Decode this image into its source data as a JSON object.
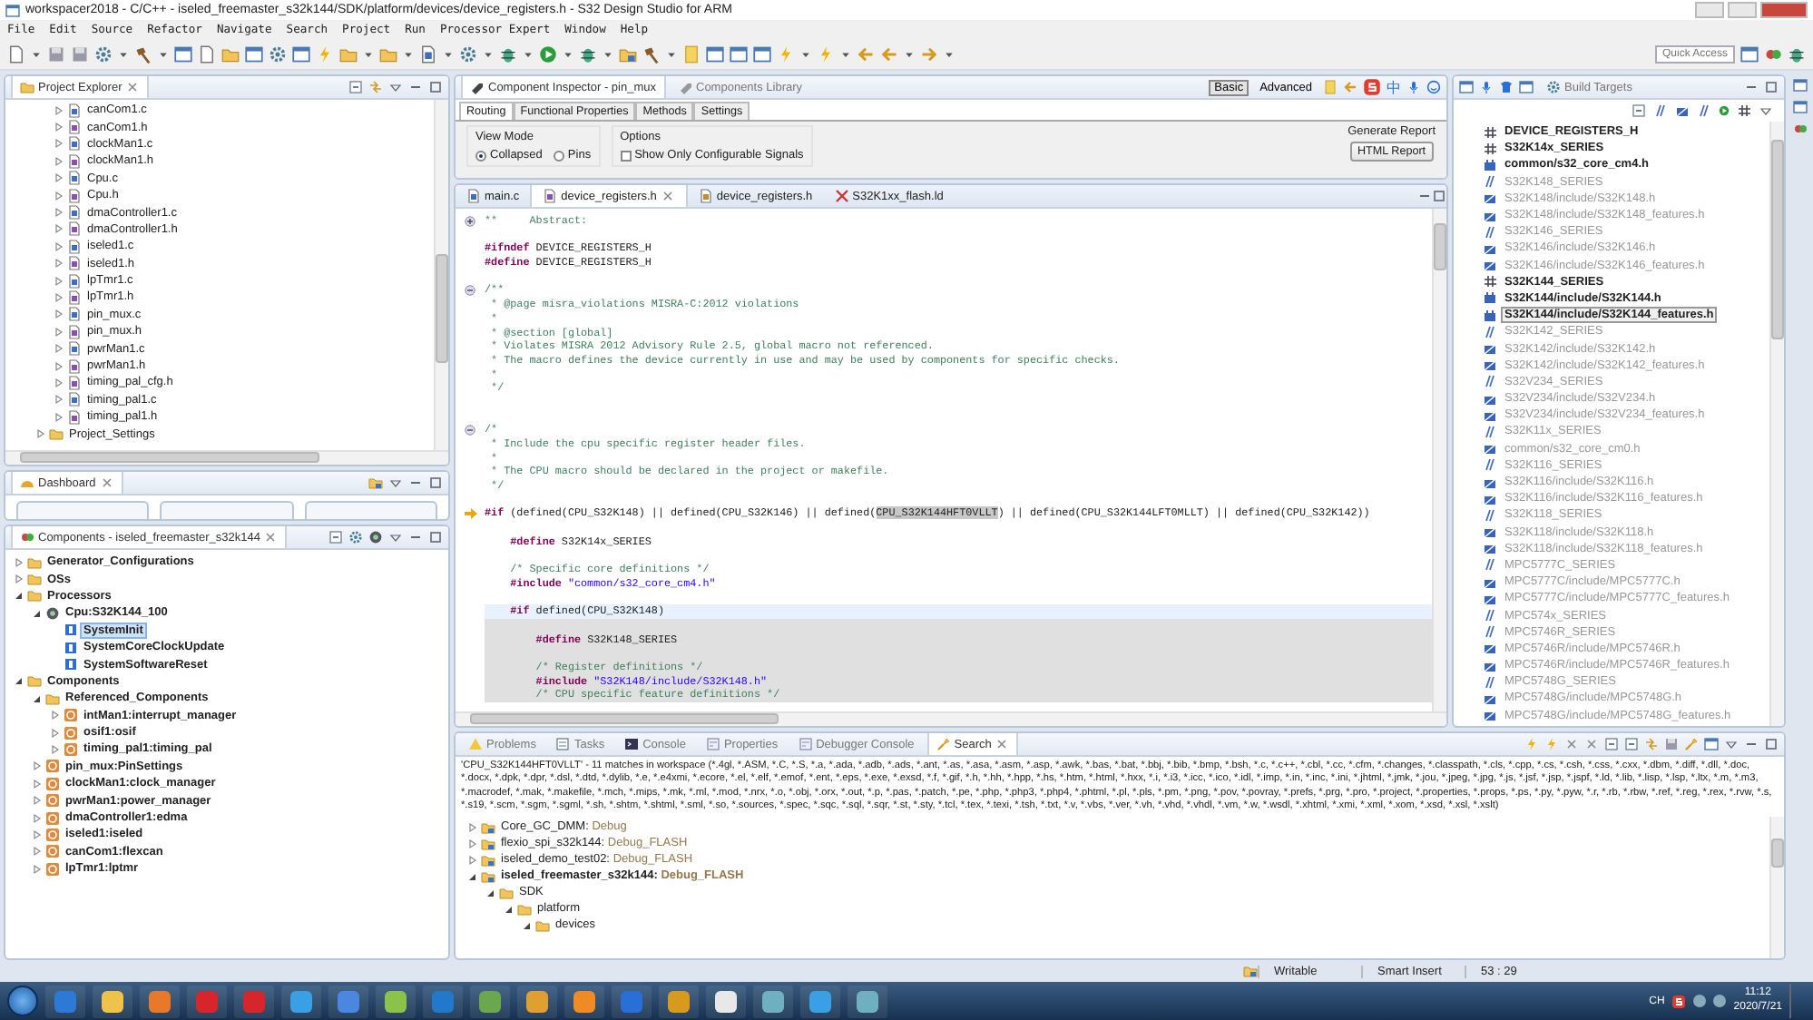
{
  "window": {
    "title": "workspacer2018 - C/C++ - iseled_freemaster_s32k144/SDK/platform/devices/device_registers.h - S32 Design Studio for ARM"
  },
  "menu": [
    "File",
    "Edit",
    "Source",
    "Refactor",
    "Navigate",
    "Search",
    "Project",
    "Run",
    "Processor Expert",
    "Window",
    "Help"
  ],
  "toolbar": {
    "quick_access": {
      "placeholder": "Quick Access"
    }
  },
  "project_explorer": {
    "title": "Project Explorer",
    "items": [
      {
        "label": "canCom1.c",
        "kind": "c"
      },
      {
        "label": "canCom1.h",
        "kind": "h"
      },
      {
        "label": "clockMan1.c",
        "kind": "c"
      },
      {
        "label": "clockMan1.h",
        "kind": "h"
      },
      {
        "label": "Cpu.c",
        "kind": "c"
      },
      {
        "label": "Cpu.h",
        "kind": "h"
      },
      {
        "label": "dmaController1.c",
        "kind": "c"
      },
      {
        "label": "dmaController1.h",
        "kind": "h"
      },
      {
        "label": "iseled1.c",
        "kind": "c"
      },
      {
        "label": "iseled1.h",
        "kind": "h"
      },
      {
        "label": "lpTmr1.c",
        "kind": "c"
      },
      {
        "label": "lpTmr1.h",
        "kind": "h"
      },
      {
        "label": "pin_mux.c",
        "kind": "c"
      },
      {
        "label": "pin_mux.h",
        "kind": "h"
      },
      {
        "label": "pwrMan1.c",
        "kind": "c"
      },
      {
        "label": "pwrMan1.h",
        "kind": "h"
      },
      {
        "label": "timing_pal_cfg.h",
        "kind": "h"
      },
      {
        "label": "timing_pal1.c",
        "kind": "c"
      },
      {
        "label": "timing_pal1.h",
        "kind": "h"
      },
      {
        "label": "Project_Settings",
        "kind": "folder"
      }
    ]
  },
  "dashboard": {
    "title": "Dashboard"
  },
  "components": {
    "title": "Components - iseled_freemaster_s32k144",
    "tree": [
      {
        "label": "Generator_Configurations",
        "kind": "folder",
        "expanded": false,
        "selected": false
      },
      {
        "label": "OSs",
        "kind": "folder",
        "expanded": false,
        "selected": false
      },
      {
        "label": "Processors",
        "kind": "folder",
        "expanded": true,
        "selected": false,
        "children": [
          {
            "label": "Cpu:S32K144_100",
            "kind": "cpu",
            "expanded": true,
            "selected": false,
            "children": [
              {
                "label": "SystemInit",
                "kind": "method",
                "selected": true
              },
              {
                "label": "SystemCoreClockUpdate",
                "kind": "method",
                "selected": false
              },
              {
                "label": "SystemSoftwareReset",
                "kind": "method",
                "selected": false
              }
            ]
          }
        ]
      },
      {
        "label": "Components",
        "kind": "folder",
        "expanded": true,
        "selected": false,
        "children": [
          {
            "label": "Referenced_Components",
            "kind": "folder",
            "expanded": true,
            "selected": false,
            "children": [
              {
                "label": "intMan1:interrupt_manager",
                "kind": "component",
                "expanded": false,
                "selected": false
              },
              {
                "label": "osif1:osif",
                "kind": "component",
                "expanded": false,
                "selected": false
              },
              {
                "label": "timing_pal1:timing_pal",
                "kind": "component",
                "expanded": false,
                "selected": false
              }
            ]
          },
          {
            "label": "pin_mux:PinSettings",
            "kind": "component",
            "expanded": false,
            "selected": false
          },
          {
            "label": "clockMan1:clock_manager",
            "kind": "component",
            "expanded": false,
            "selected": false
          },
          {
            "label": "pwrMan1:power_manager",
            "kind": "component",
            "expanded": false,
            "selected": false
          },
          {
            "label": "dmaController1:edma",
            "kind": "component",
            "expanded": false,
            "selected": false
          },
          {
            "label": "iseled1:iseled",
            "kind": "component",
            "expanded": false,
            "selected": false
          },
          {
            "label": "canCom1:flexcan",
            "kind": "component",
            "expanded": false,
            "selected": false
          },
          {
            "label": "lpTmr1:lptmr",
            "kind": "component",
            "expanded": false,
            "selected": false
          }
        ]
      }
    ]
  },
  "inspector": {
    "tabs": [
      {
        "label": "Component Inspector - pin_mux",
        "selected": true
      },
      {
        "label": "Components Library",
        "selected": false
      }
    ],
    "modes": [
      {
        "label": "Basic",
        "selected": true
      },
      {
        "label": "Advanced",
        "selected": false
      }
    ],
    "ime_mode": "中",
    "subtabs": [
      {
        "label": "Routing",
        "selected": true
      },
      {
        "label": "Functional Properties",
        "selected": false
      },
      {
        "label": "Methods",
        "selected": false
      },
      {
        "label": "Settings",
        "selected": false
      }
    ],
    "view_mode": {
      "label": "View Mode",
      "options": [
        {
          "label": "Collapsed",
          "selected": true
        },
        {
          "label": "Pins",
          "selected": false
        }
      ]
    },
    "options": {
      "label": "Options",
      "checkbox": {
        "label": "Show Only Configurable Signals",
        "checked": false
      }
    },
    "report": {
      "label": "Generate Report",
      "button": "HTML Report"
    }
  },
  "editor": {
    "tabs": [
      {
        "label": "main.c",
        "kind": "c",
        "selected": false
      },
      {
        "label": "device_registers.h",
        "kind": "h",
        "selected": true
      },
      {
        "label": "device_registers.h",
        "kind": "h-external",
        "selected": false
      },
      {
        "label": "S32K1xx_flash.ld",
        "kind": "linker",
        "selected": false
      }
    ],
    "lines": [
      {
        "kind": "normal",
        "gutter": {
          "kind": "fold-expand"
        },
        "segments": [
          {
            "kind": "comment",
            "text": "**     Abstract:"
          }
        ]
      },
      {
        "kind": "normal"
      },
      {
        "kind": "normal",
        "segments": [
          {
            "kind": "keyword",
            "text": "#ifndef"
          },
          {
            "kind": "plain",
            "text": " DEVICE_REGISTERS_H"
          }
        ]
      },
      {
        "kind": "normal",
        "segments": [
          {
            "kind": "keyword",
            "text": "#define"
          },
          {
            "kind": "plain",
            "text": " DEVICE_REGISTERS_H"
          }
        ]
      },
      {
        "kind": "normal"
      },
      {
        "kind": "normal",
        "gutter": {
          "kind": "fold-collapse"
        },
        "segments": [
          {
            "kind": "comment",
            "text": "/**"
          }
        ]
      },
      {
        "kind": "normal",
        "segments": [
          {
            "kind": "comment",
            "text": " * @page misra_violations MISRA-C:2012 violations"
          }
        ]
      },
      {
        "kind": "normal",
        "segments": [
          {
            "kind": "comment",
            "text": " *"
          }
        ]
      },
      {
        "kind": "normal",
        "segments": [
          {
            "kind": "comment",
            "text": " * @section [global]"
          }
        ]
      },
      {
        "kind": "normal",
        "segments": [
          {
            "kind": "comment",
            "text": " * Violates MISRA 2012 Advisory Rule 2.5, global macro not referenced."
          }
        ]
      },
      {
        "kind": "normal",
        "segments": [
          {
            "kind": "comment",
            "text": " * The macro defines the device currently in use and may be used by components for specific checks."
          }
        ]
      },
      {
        "kind": "normal",
        "segments": [
          {
            "kind": "comment",
            "text": " *"
          }
        ]
      },
      {
        "kind": "normal",
        "segments": [
          {
            "kind": "comment",
            "text": " */"
          }
        ]
      },
      {
        "kind": "normal"
      },
      {
        "kind": "normal"
      },
      {
        "kind": "normal",
        "gutter": {
          "kind": "fold-collapse"
        },
        "segments": [
          {
            "kind": "comment",
            "text": "/*"
          }
        ]
      },
      {
        "kind": "normal",
        "segments": [
          {
            "kind": "comment",
            "text": " * Include the cpu specific register header files."
          }
        ]
      },
      {
        "kind": "normal",
        "segments": [
          {
            "kind": "comment",
            "text": " *"
          }
        ]
      },
      {
        "kind": "normal",
        "segments": [
          {
            "kind": "comment",
            "text": " * The CPU macro should be declared in the project or makefile."
          }
        ]
      },
      {
        "kind": "normal",
        "segments": [
          {
            "kind": "comment",
            "text": " */"
          }
        ]
      },
      {
        "kind": "normal"
      },
      {
        "kind": "normal",
        "gutter": {
          "kind": "arrow"
        },
        "segments": [
          {
            "kind": "keyword",
            "text": "#if"
          },
          {
            "kind": "plain",
            "text": " (defined(CPU_S32K148) || defined(CPU_S32K146) || defined("
          },
          {
            "kind": "match",
            "text": "CPU_S32K144HFT0VLLT"
          },
          {
            "kind": "plain",
            "text": ") || defined(CPU_S32K144LFT0MLLT) || defined(CPU_S32K142))"
          }
        ]
      },
      {
        "kind": "normal"
      },
      {
        "kind": "normal",
        "segments": [
          {
            "kind": "keyword",
            "text": "    #define"
          },
          {
            "kind": "plain",
            "text": " S32K14x_SERIES"
          }
        ]
      },
      {
        "kind": "normal"
      },
      {
        "kind": "normal",
        "segments": [
          {
            "kind": "comment",
            "text": "    /* Specific core definitions */"
          }
        ]
      },
      {
        "kind": "normal",
        "segments": [
          {
            "kind": "keyword",
            "text": "    #include"
          },
          {
            "kind": "string",
            "text": " \"common/s32_core_cm4.h\""
          }
        ]
      },
      {
        "kind": "normal"
      },
      {
        "kind": "current",
        "segments": [
          {
            "kind": "keyword",
            "text": "    #if"
          },
          {
            "kind": "plain",
            "text": " defined(CPU_S32K148)"
          }
        ]
      },
      {
        "kind": "inactive"
      },
      {
        "kind": "inactive",
        "segments": [
          {
            "kind": "keyword",
            "text": "        #define"
          },
          {
            "kind": "plain",
            "text": " S32K148_SERIES"
          }
        ]
      },
      {
        "kind": "inactive"
      },
      {
        "kind": "inactive",
        "segments": [
          {
            "kind": "comment",
            "text": "        /* Register definitions */"
          }
        ]
      },
      {
        "kind": "inactive",
        "segments": [
          {
            "kind": "keyword",
            "text": "        #include"
          },
          {
            "kind": "string",
            "text": " \"S32K148/include/S32K148.h\""
          }
        ]
      },
      {
        "kind": "inactive",
        "segments": [
          {
            "kind": "comment",
            "text": "        /* CPU specific feature definitions */"
          }
        ]
      }
    ]
  },
  "outline": {
    "build_targets_tab": "Build Targets",
    "items": [
      {
        "label": "DEVICE_REGISTERS_H",
        "kind": "define",
        "active": true,
        "selected": false
      },
      {
        "label": "S32K14x_SERIES",
        "kind": "define",
        "active": true,
        "selected": false
      },
      {
        "label": "common/s32_core_cm4.h",
        "kind": "include",
        "active": true,
        "selected": false
      },
      {
        "label": "S32K148_SERIES",
        "kind": "define",
        "active": false,
        "selected": false
      },
      {
        "label": "S32K148/include/S32K148.h",
        "kind": "include",
        "active": false,
        "selected": false
      },
      {
        "label": "S32K148/include/S32K148_features.h",
        "kind": "include",
        "active": false,
        "selected": false
      },
      {
        "label": "S32K146_SERIES",
        "kind": "define",
        "active": false,
        "selected": false
      },
      {
        "label": "S32K146/include/S32K146.h",
        "kind": "include",
        "active": false,
        "selected": false
      },
      {
        "label": "S32K146/include/S32K146_features.h",
        "kind": "include",
        "active": false,
        "selected": false
      },
      {
        "label": "S32K144_SERIES",
        "kind": "define",
        "active": true,
        "selected": false
      },
      {
        "label": "S32K144/include/S32K144.h",
        "kind": "include",
        "active": true,
        "selected": false
      },
      {
        "label": "S32K144/include/S32K144_features.h",
        "kind": "include",
        "active": true,
        "selected": true
      },
      {
        "label": "S32K142_SERIES",
        "kind": "define",
        "active": false,
        "selected": false
      },
      {
        "label": "S32K142/include/S32K142.h",
        "kind": "include",
        "active": false,
        "selected": false
      },
      {
        "label": "S32K142/include/S32K142_features.h",
        "kind": "include",
        "active": false,
        "selected": false
      },
      {
        "label": "S32V234_SERIES",
        "kind": "define",
        "active": false,
        "selected": false
      },
      {
        "label": "S32V234/include/S32V234.h",
        "kind": "include",
        "active": false,
        "selected": false
      },
      {
        "label": "S32V234/include/S32V234_features.h",
        "kind": "include",
        "active": false,
        "selected": false
      },
      {
        "label": "S32K11x_SERIES",
        "kind": "define",
        "active": false,
        "selected": false
      },
      {
        "label": "common/s32_core_cm0.h",
        "kind": "include",
        "active": false,
        "selected": false
      },
      {
        "label": "S32K116_SERIES",
        "kind": "define",
        "active": false,
        "selected": false
      },
      {
        "label": "S32K116/include/S32K116.h",
        "kind": "include",
        "active": false,
        "selected": false
      },
      {
        "label": "S32K116/include/S32K116_features.h",
        "kind": "include",
        "active": false,
        "selected": false
      },
      {
        "label": "S32K118_SERIES",
        "kind": "define",
        "active": false,
        "selected": false
      },
      {
        "label": "S32K118/include/S32K118.h",
        "kind": "include",
        "active": false,
        "selected": false
      },
      {
        "label": "S32K118/include/S32K118_features.h",
        "kind": "include",
        "active": false,
        "selected": false
      },
      {
        "label": "MPC5777C_SERIES",
        "kind": "define",
        "active": false,
        "selected": false
      },
      {
        "label": "MPC5777C/include/MPC5777C.h",
        "kind": "include",
        "active": false,
        "selected": false
      },
      {
        "label": "MPC5777C/include/MPC5777C_features.h",
        "kind": "include",
        "active": false,
        "selected": false
      },
      {
        "label": "MPC574x_SERIES",
        "kind": "define",
        "active": false,
        "selected": false
      },
      {
        "label": "MPC5746R_SERIES",
        "kind": "define",
        "active": false,
        "selected": false
      },
      {
        "label": "MPC5746R/include/MPC5746R.h",
        "kind": "include",
        "active": false,
        "selected": false
      },
      {
        "label": "MPC5746R/include/MPC5746R_features.h",
        "kind": "include",
        "active": false,
        "selected": false
      },
      {
        "label": "MPC5748G_SERIES",
        "kind": "define",
        "active": false,
        "selected": false
      },
      {
        "label": "MPC5748G/include/MPC5748G.h",
        "kind": "include",
        "active": false,
        "selected": false
      },
      {
        "label": "MPC5748G/include/MPC5748G_features.h",
        "kind": "include",
        "active": false,
        "selected": false
      }
    ]
  },
  "bottom_panel": {
    "tabs": [
      {
        "label": "Problems",
        "kind": "problems",
        "selected": false
      },
      {
        "label": "Tasks",
        "kind": "tasks",
        "selected": false
      },
      {
        "label": "Console",
        "kind": "console",
        "selected": false
      },
      {
        "label": "Properties",
        "kind": "properties",
        "selected": false
      },
      {
        "label": "Debugger Console",
        "kind": "properties",
        "selected": false
      },
      {
        "label": "Search",
        "kind": "search",
        "selected": true
      }
    ],
    "message": "'CPU_S32K144HFT0VLLT' - 11 matches in workspace (*.4gl, *.ASM, *.C, *.S, *.a, *.ada, *.adb, *.ads, *.ant, *.as, *.asa, *.asm, *.asp, *.awk, *.bas, *.bat, *.bbj, *.bib, *.bmp, *.bsh, *.c, *.c++, *.cbl, *.cc, *.cfm, *.changes, *.classpath, *.cls, *.cpp, *.cs, *.csh, *.css, *.cxx, *.dbm, *.diff, *.dll, *.doc, *.docx, *.dpk, *.dpr, *.dsl, *.dtd, *.dylib, *.e, *.e4xmi, *.ecore, *.el, *.elf, *.emof, *.ent, *.eps, *.exe, *.exsd, *.f, *.gif, *.h, *.hh, *.hpp, *.hs, *.htm, *.html, *.hxx, *.i, *.i3, *.icc, *.ico, *.idl, *.imp, *.in, *.inc, *.ini, *.jhtml, *.jmk, *.jou, *.jpeg, *.jpg, *.js, *.jsf, *.jsp, *.jspf, *.ld, *.lib, *.lisp, *.lsp, *.ltx, *.m, *.m3, *.macrodef, *.mak, *.makefile, *.mch, *.mips, *.mk, *.ml, *.mod, *.nrx, *.o, *.obj, *.orx, *.out, *.p, *.pas, *.patch, *.pe, *.php, *.php3, *.php4, *.phtml, *.pl, *.pls, *.pm, *.png, *.pov, *.povray, *.prefs, *.prg, *.pro, *.project, *.properties, *.props, *.ps, *.py, *.pyw, *.r, *.rb, *.rbw, *.ref, *.reg, *.rex, *.rvw, *.s, *.s19, *.scm, *.sgm, *.sgml, *.sh, *.shtm, *.shtml, *.sml, *.so, *.sources, *.spec, *.sqc, *.sql, *.sqr, *.st, *.sty, *.tcl, *.tex, *.texi, *.tsh, *.txt, *.v, *.vbs, *.ver, *.vh, *.vhd, *.vhdl, *.vm, *.w, *.wsdl, *.xhtml, *.xmi, *.xml, *.xom, *.xsd, *.xsl, *.xslt)",
    "results": [
      {
        "label": "Core_GC_DMM:",
        "config": "Debug",
        "kind": "project",
        "expanded": false,
        "emphasized": false
      },
      {
        "label": "flexio_spi_s32k144:",
        "config": "Debug_FLASH",
        "kind": "project",
        "expanded": false,
        "emphasized": false
      },
      {
        "label": "iseled_demo_test02:",
        "config": "Debug_FLASH",
        "kind": "project",
        "expanded": false,
        "emphasized": false
      },
      {
        "label": "iseled_freemaster_s32k144:",
        "config": "Debug_FLASH",
        "kind": "project",
        "expanded": true,
        "emphasized": true,
        "children": [
          {
            "label": "SDK",
            "kind": "folder",
            "expanded": true,
            "emphasized": false,
            "children": [
              {
                "label": "platform",
                "kind": "folder",
                "expanded": true,
                "emphasized": false,
                "children": [
                  {
                    "label": "devices",
                    "kind": "folder",
                    "expanded": true,
                    "emphasized": false
                  }
                ]
              }
            ]
          }
        ]
      }
    ]
  },
  "status_bar": {
    "fields": [
      "Writable",
      "Smart Insert",
      "53 : 29"
    ]
  },
  "taskbar": {
    "language": "CH",
    "time": "11:12",
    "date": "2020/7/21"
  }
}
